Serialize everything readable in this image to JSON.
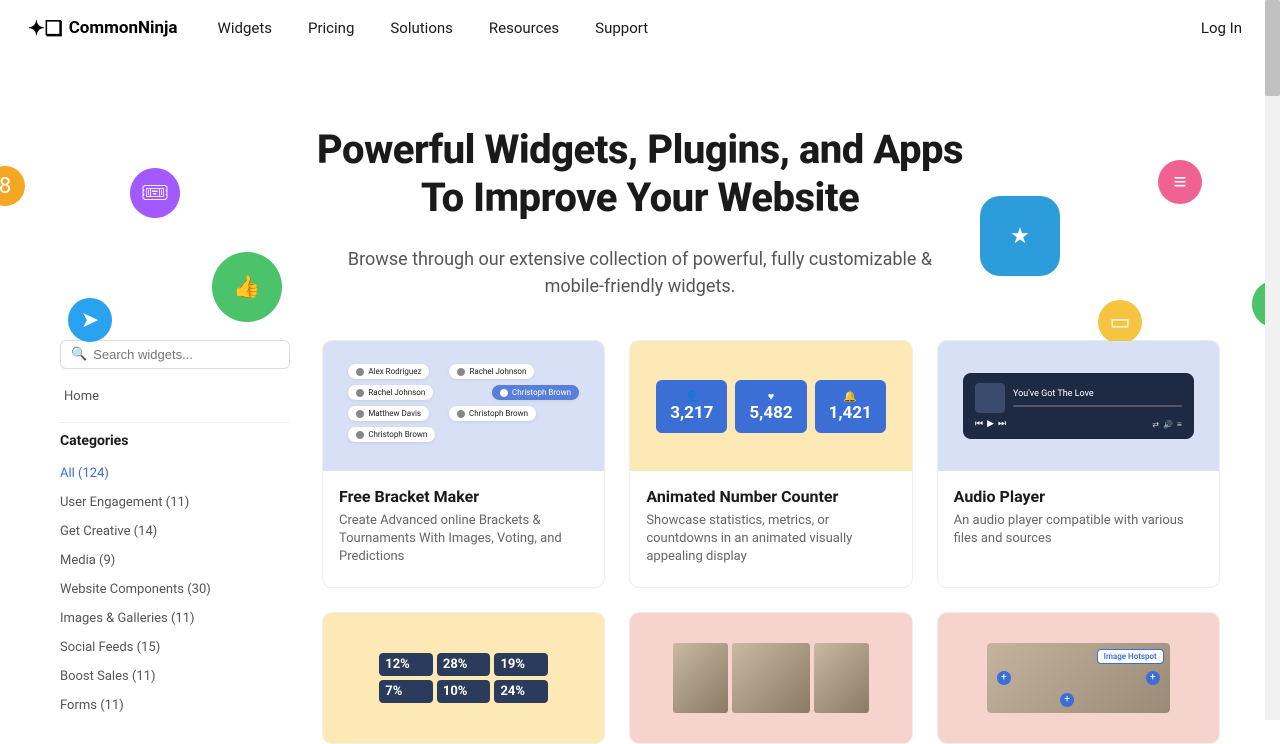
{
  "nav": {
    "logo": "CommonNinja",
    "items": [
      "Widgets",
      "Pricing",
      "Solutions",
      "Resources",
      "Support"
    ],
    "login": "Log In"
  },
  "hero": {
    "title_l1": "Powerful Widgets, Plugins, and Apps",
    "title_l2": "To Improve Your Website",
    "subtitle": "Browse through our extensive collection of powerful, fully customizable & mobile-friendly widgets."
  },
  "sidebar": {
    "search_placeholder": "Search widgets...",
    "home": "Home",
    "categories_title": "Categories",
    "categories": [
      "All (124)",
      "User Engagement (11)",
      "Get Creative (14)",
      "Media (9)",
      "Website Components (30)",
      "Images & Galleries (11)",
      "Social Feeds (15)",
      "Boost Sales (11)",
      "Forms (11)"
    ]
  },
  "cards": [
    {
      "title": "Free Bracket Maker",
      "desc": "Create Advanced online Brackets & Tournaments With Images, Voting, and Predictions"
    },
    {
      "title": "Animated Number Counter",
      "desc": "Showcase statistics, metrics, or countdowns in an animated visually appealing display",
      "counters": [
        "3,217",
        "5,482",
        "1,421"
      ]
    },
    {
      "title": "Audio Player",
      "desc": "An audio player compatible with various files and sources",
      "track": "You've Got The Love"
    }
  ],
  "bracket_names": [
    "Alex Rodriguez",
    "Rachel Johnson",
    "Matthew Davis",
    "Christoph Brown",
    "Rachel Johnson",
    "Christoph Brown",
    "Christoph Brown"
  ],
  "pct_values": [
    "12%",
    "28%",
    "19%",
    "7%",
    "10%",
    "24%"
  ],
  "hotspot_label": "Image Hotspot"
}
